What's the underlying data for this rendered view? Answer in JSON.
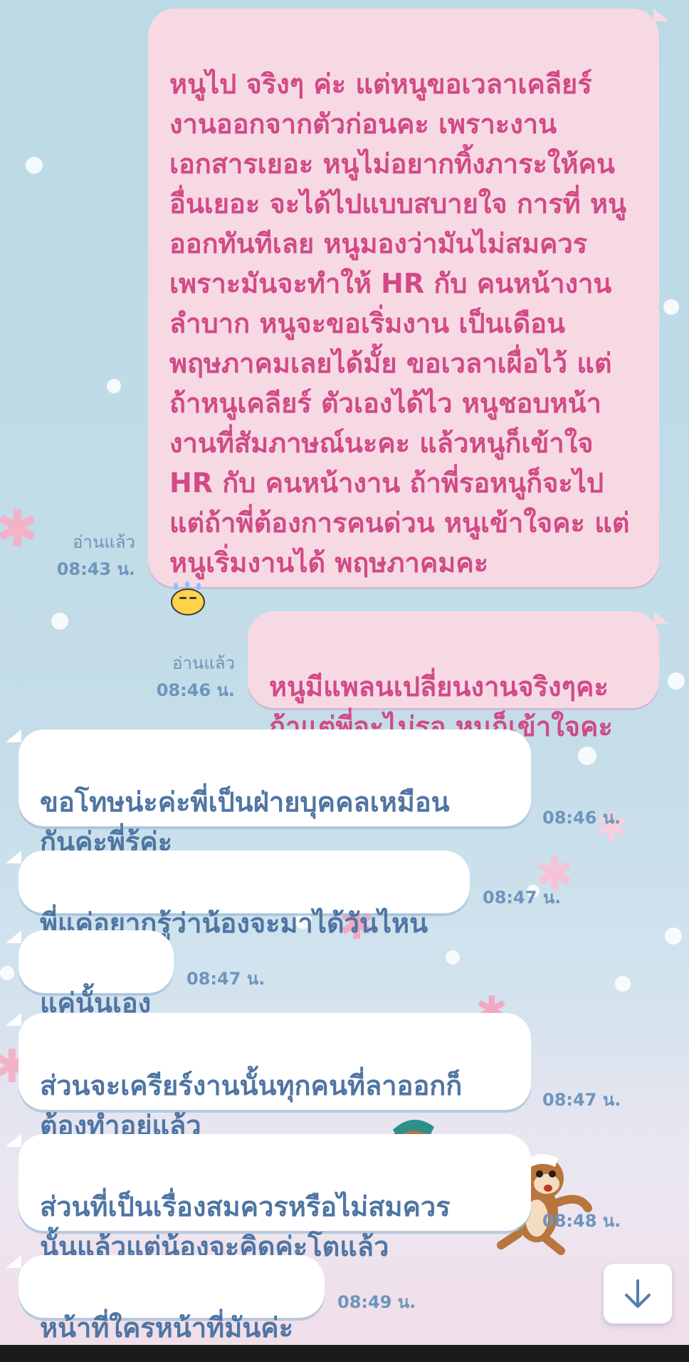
{
  "colors": {
    "outgoing_bubble": "#f7d9e4",
    "outgoing_text": "#d14a86",
    "incoming_bubble": "#ffffff",
    "incoming_text": "#4f75a3",
    "meta_text": "#6d95bd"
  },
  "messages": {
    "out1": {
      "text": "หนูไป จริงๆ ค่ะ แต่หนูขอเวลาเคลียร์งานออกจากตัวก่อนคะ เพราะงานเอกสารเยอะ หนูไม่อยากทิ้งภาระให้คนอื่นเยอะ จะได้ไปแบบสบายใจ การที่ หนูออกทันทีเลย หนูมองว่ามันไม่สมควร เพราะมันจะทำให้ HR กับ คนหน้างานลำบาก หนูจะขอเริ่มงาน เป็นเดือนพฤษภาคมเลยได้มั้ย ขอเวลาเผื่อไว้ แต่ถ้าหนูเคลียร์ ตัวเองได้ไว หนูชอบหน้างานที่สัมภาษณ์นะคะ แล้วหนูก็เข้าใจ HR กับ คนหน้างาน ถ้าพี่รอหนูก็จะไป แต่ถ้าพี่ต้องการคนด่วน หนูเข้าใจคะ แต่หนูเริ่มงานได้ พฤษภาคมคะ",
      "emoji": "sweat-smile-emoji",
      "read": "อ่านแล้ว",
      "time": "08:43 น."
    },
    "out2": {
      "text": "หนูมีแพลนเปลี่ยนงานจริงๆคะ\nถ้าแต่พี่จะไม่รอ หนูก็เข้าใจคะ",
      "read": "อ่านแล้ว",
      "time": "08:46 น."
    },
    "in1": {
      "text": "ขอโทษน่ะค่ะพี่เป็นฝ่ายบุคคลเหมือน\nกันค่ะพี่รู้ค่ะ",
      "time": "08:46 น."
    },
    "in2": {
      "text": "พี่แค่อยากรู้ว่าน้องจะมาได้วันไหน",
      "time": "08:47 น."
    },
    "in3": {
      "text": "แค่นั้นเอง",
      "time": "08:47 น."
    },
    "in4": {
      "text": "ส่วนจะเครียร์งานนั้นทุกคนที่ลาออกก็\nต้องทำอยู่แล้ว",
      "time": "08:47 น."
    },
    "in5": {
      "text": "ส่วนที่เป็นเรื่องสมควรหรือไม่สมควร\nนั้นแล้วแต่น้องจะคิดค่ะโตแล้ว",
      "time": "08:48 น."
    },
    "in6": {
      "text": "หน้าที่ใครหน้าที่มันค่ะ",
      "time": "08:49 น."
    }
  },
  "controls": {
    "scroll_down_icon": "arrow-down-icon"
  }
}
